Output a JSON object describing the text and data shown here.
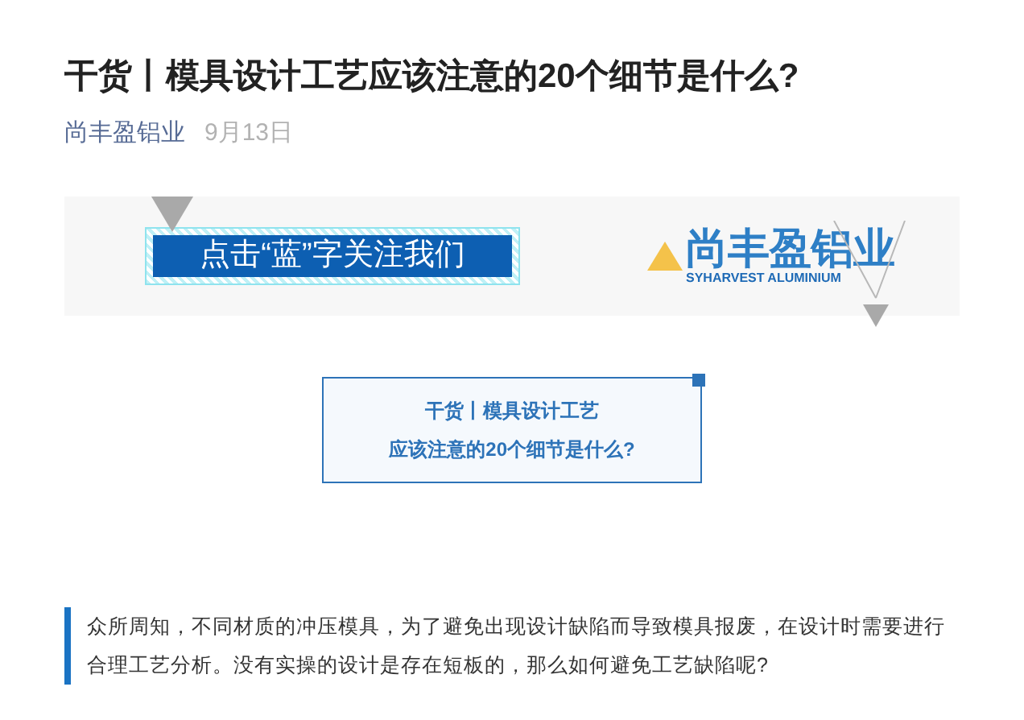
{
  "article": {
    "title": "干货丨模具设计工艺应该注意的20个细节是什么?",
    "author": "尚丰盈铝业",
    "date": "9月13日"
  },
  "banner": {
    "follow_text": "点击“蓝”字关注我们",
    "logo_name": "尚丰盈铝业",
    "logo_subtitle": "SYHARVEST ALUMINIUM"
  },
  "title_card": {
    "lines": [
      "干货丨模具设计工艺",
      "应该注意的20个细节是什么?"
    ]
  },
  "intro": "众所周知，不同材质的冲压模具，为了避免出现设计缺陷而导致模具报废，在设计时需要进行合理工艺分析。没有实操的设计是存在短板的，那么如何避免工艺缺陷呢?"
}
